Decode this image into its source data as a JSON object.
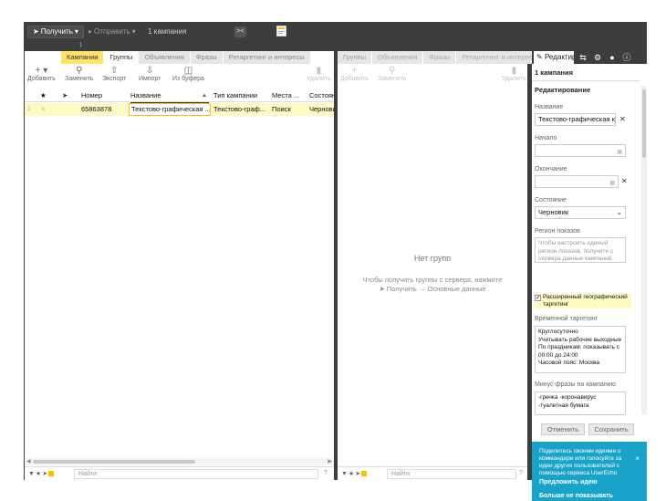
{
  "toolbar": {
    "receive_label": "Получить",
    "send_label": "Отправить",
    "campaign_count": "1 кампания",
    "marker": "1"
  },
  "left_panel": {
    "tabs": [
      "Кампании",
      "Группы",
      "Объявления",
      "Фразы",
      "Ретаргетинг и интересы"
    ],
    "actions": {
      "add": "Добавить",
      "replace": "Заменить",
      "export": "Экспорт",
      "import": "Импорт",
      "from_buffer": "Из буфера",
      "delete": "Удалить"
    },
    "columns": [
      "★",
      "",
      "Номер",
      "Название",
      "Тип кампании",
      "Места ...",
      "Состояние"
    ],
    "rows": [
      {
        "index": "1",
        "number": "65863878",
        "name": "Текстово-графическая ...",
        "type": "Текстово-граф...",
        "places": "Поиск",
        "state": "Черновик"
      }
    ],
    "find_placeholder": "Найти",
    "help": "?"
  },
  "middle_panel": {
    "tabs": [
      "Группы",
      "Объявления",
      "Фразы",
      "Ретаргетинг и интересы"
    ],
    "actions": {
      "add": "Добавить",
      "replace": "Заменить",
      "delete": "Удалить"
    },
    "empty_title": "Нет групп",
    "empty_text_1": "Чтобы получить группы с сервера, нажмите",
    "empty_text_receive": "Получить",
    "empty_text_arrow": "→",
    "empty_text_basic": "Основные данные",
    "find_placeholder": "Найти",
    "help": "?"
  },
  "right_panel": {
    "edit_tab": "Редактирование",
    "subtitle": "1 кампания",
    "heading": "Редактирование",
    "name_label": "Название",
    "name_value": "Текстово-графическая кампания",
    "start_label": "Начало",
    "end_label": "Окончание",
    "state_label": "Состояние",
    "state_value": "Черновик",
    "region_label": "Регион показов",
    "region_hint": "Чтобы настроить единый регион показов, получите с сервера данные кампаний.",
    "geo_checkbox": "Расширенный географический таргетинг",
    "time_label": "Временной таргетинг",
    "time_lines": [
      "Круглосуточно",
      "Учитывать рабочие выходные",
      "По праздникам: показывать с 00:00 до 24:00",
      "Часовой пояс: Москва"
    ],
    "minus_label": "Минус-фразы на кампанию",
    "minus_value": "-гречка -коронавирус -туалетная бумага",
    "cancel": "Отменить",
    "save": "Сохранить"
  },
  "promo": {
    "text": "Поделитесь своими идеями о коммандере или голосуйте за идеи других пользователей с помощью сервиса UserEcho",
    "suggest": "Предложить идею",
    "hide": "Больше не показывать",
    "close": "×"
  },
  "icons": {
    "receive": "send-arrow-icon",
    "send": "play-icon",
    "collapse": "collapse-icon",
    "notes": "notes-icon",
    "star": "star-icon",
    "tag": "tag-icon",
    "pencil": "pencil-icon",
    "settings": "sliders-icon",
    "gear": "gear-icon",
    "comment": "comment-icon",
    "info": "info-icon"
  },
  "colors": {
    "app_bg": "#3d3d3d",
    "accent_yellow": "#ffe36b",
    "row_highlight": "#fff9c4",
    "promo_bg": "#1aa3c8"
  }
}
